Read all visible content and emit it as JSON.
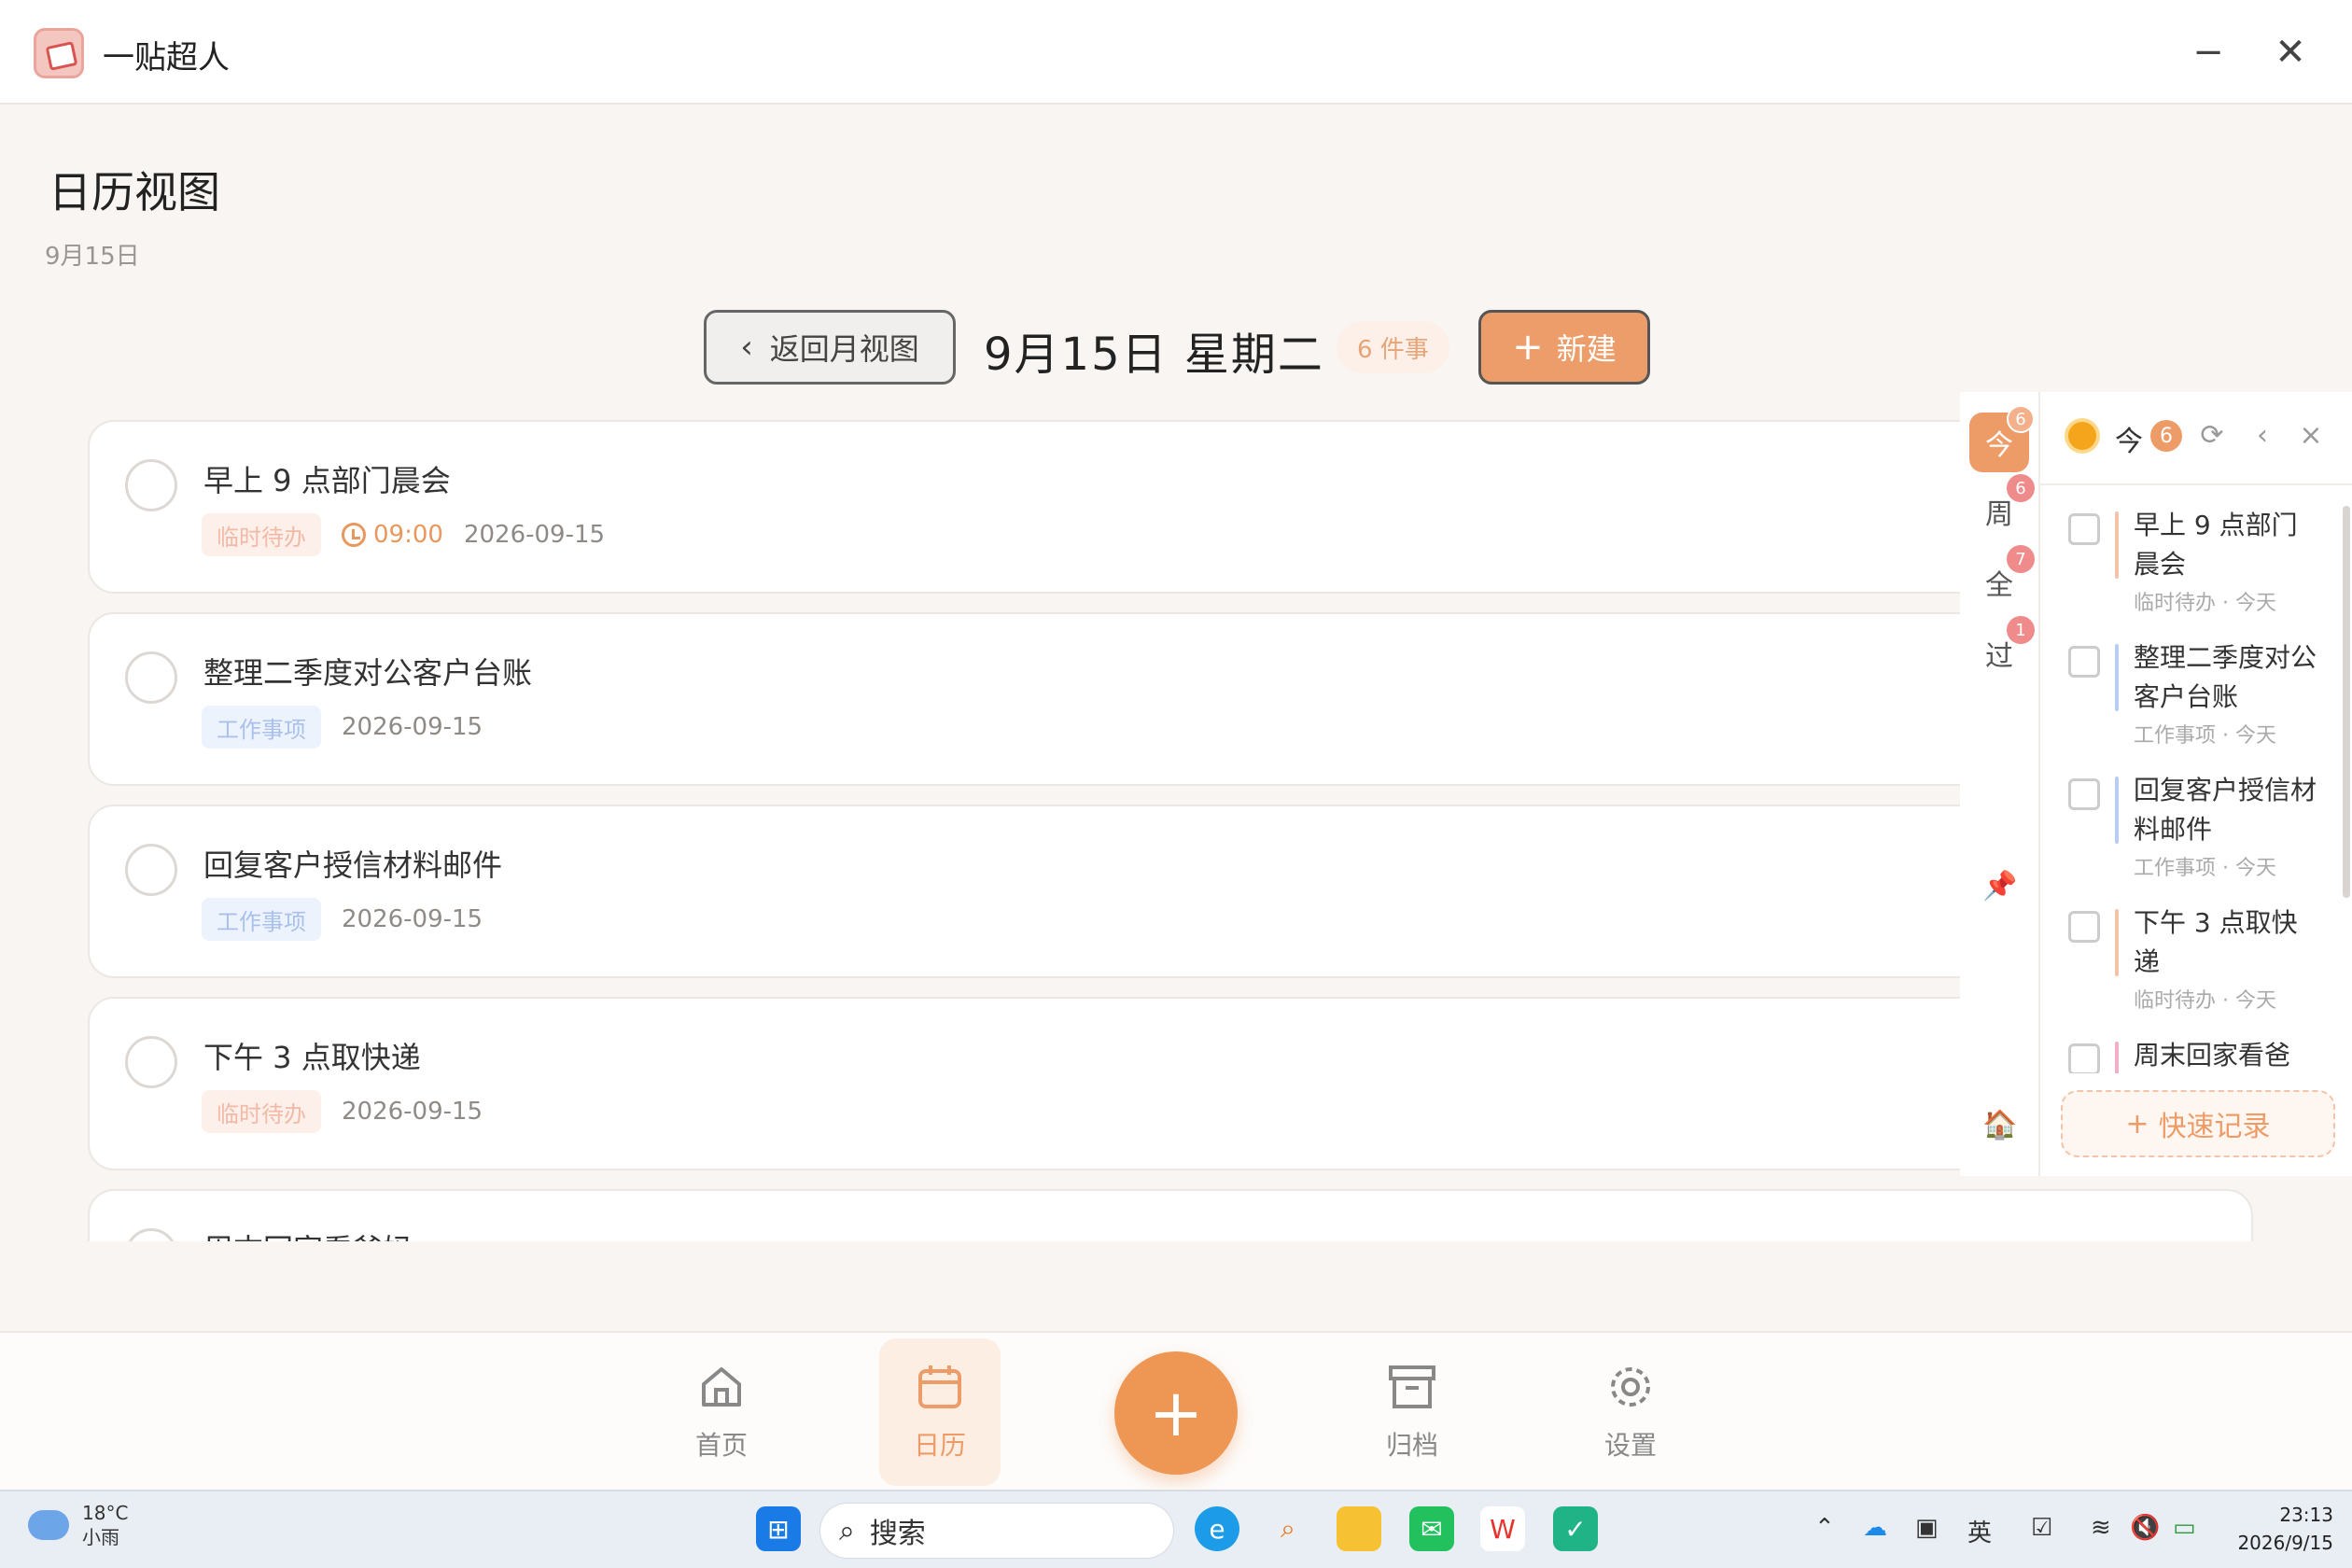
{
  "window": {
    "title": "一贴超人",
    "minimize": "−",
    "close": "✕"
  },
  "page": {
    "title": "日历视图",
    "subtitle": "9月15日"
  },
  "day_header": {
    "back_label": "返回月视图",
    "date_label": "9月15日 星期二",
    "count_label": "6 件事",
    "new_label": "新建"
  },
  "tasks": [
    {
      "title": "早上 9 点部门晨会",
      "tag": "临时待办",
      "time": "09:00",
      "date": "2026-09-15"
    },
    {
      "title": "整理二季度对公客户台账",
      "tag": "工作事项",
      "date": "2026-09-15"
    },
    {
      "title": "回复客户授信材料邮件",
      "tag": "工作事项",
      "date": "2026-09-15"
    },
    {
      "title": "下午 3 点取快递",
      "tag": "临时待办",
      "date": "2026-09-15"
    },
    {
      "title": "周末回家看爸妈"
    }
  ],
  "side_tabs": [
    {
      "label": "今",
      "count": "6"
    },
    {
      "label": "周",
      "count": "6"
    },
    {
      "label": "全",
      "count": "7"
    },
    {
      "label": "过",
      "count": "1"
    }
  ],
  "side_panel": {
    "header_label": "今",
    "header_count": "6",
    "items": [
      {
        "title": "早上 9 点部门晨会",
        "meta": "临时待办 · 今天",
        "color": "#f3c4a8"
      },
      {
        "title": "整理二季度对公客户台账",
        "meta": "工作事项 · 今天",
        "color": "#b9cdf0"
      },
      {
        "title": "回复客户授信材料邮件",
        "meta": "工作事项 · 今天",
        "color": "#b9cdf0"
      },
      {
        "title": "下午 3 点取快递",
        "meta": "临时待办 · 今天",
        "color": "#f3c4a8"
      },
      {
        "title": "周末回家看爸",
        "meta": "",
        "color": "#f2b0c8"
      }
    ],
    "quick_label": "快速记录"
  },
  "bottom_nav": {
    "home": "首页",
    "calendar": "日历",
    "archive": "归档",
    "settings": "设置",
    "fab": "+"
  },
  "taskbar": {
    "temperature": "18°C",
    "weather": "小雨",
    "search_placeholder": "搜索",
    "time": "23:13",
    "date": "2026/9/15"
  },
  "colors": {
    "accent": "#ee9c67",
    "temp_tag": "#f2b9a6",
    "work_tag": "#a9c1ea"
  }
}
